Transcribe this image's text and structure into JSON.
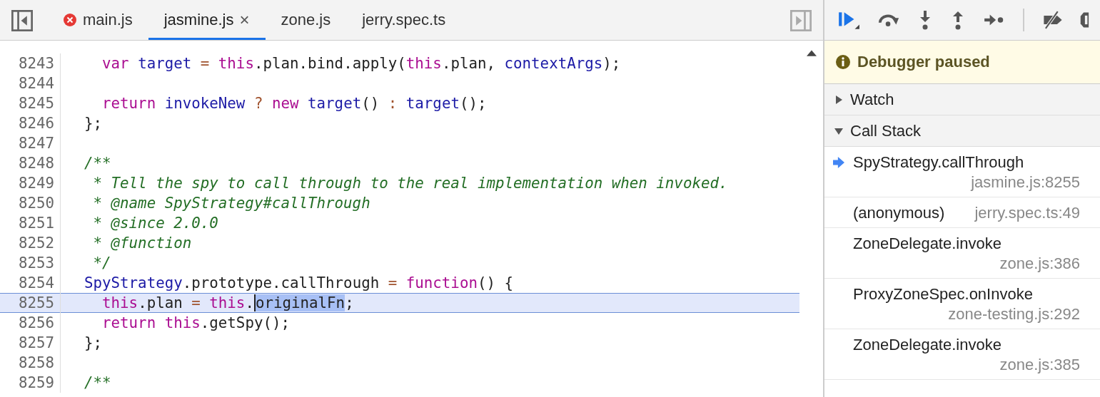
{
  "tabs": [
    {
      "label": "main.js",
      "selected": false,
      "error": true
    },
    {
      "label": "jasmine.js",
      "selected": true,
      "close": "×"
    },
    {
      "label": "zone.js",
      "selected": false
    },
    {
      "label": "jerry.spec.ts",
      "selected": false
    }
  ],
  "code": [
    {
      "num": "8243",
      "selected": false,
      "tokens": [
        {
          "t": "  var",
          "kind": "kw"
        },
        {
          "t": " target",
          "kind": "def"
        },
        {
          "t": " =",
          "kind": "op"
        },
        {
          "t": " this",
          "kind": "kw"
        },
        {
          "t": ".plan.bind.apply(",
          "kind": "plain"
        },
        {
          "t": "this",
          "kind": "kw"
        },
        {
          "t": ".plan, ",
          "kind": "plain"
        },
        {
          "t": "contextArgs",
          "kind": "def"
        },
        {
          "t": ");",
          "kind": "plain"
        }
      ]
    },
    {
      "num": "8244",
      "selected": false
    },
    {
      "num": "8245",
      "selected": false,
      "tokens": [
        {
          "t": "  return",
          "kind": "kw"
        },
        {
          "t": " invokeNew",
          "kind": "def"
        },
        {
          "t": " ?",
          "kind": "op"
        },
        {
          "t": " new",
          "kind": "kw"
        },
        {
          "t": " target",
          "kind": "def"
        },
        {
          "t": "()",
          "kind": "plain"
        },
        {
          "t": " :",
          "kind": "op"
        },
        {
          "t": " target",
          "kind": "def"
        },
        {
          "t": "();",
          "kind": "plain"
        }
      ]
    },
    {
      "num": "8246",
      "selected": false,
      "tokens": [
        {
          "t": "};",
          "kind": "plain"
        }
      ]
    },
    {
      "num": "8247",
      "selected": false
    },
    {
      "num": "8248",
      "selected": false,
      "tokens": [
        {
          "t": "/**",
          "kind": "comment"
        }
      ]
    },
    {
      "num": "8249",
      "selected": false,
      "tokens": [
        {
          "t": " * Tell the spy to call through to the real implementation when invoked.",
          "kind": "comment"
        }
      ]
    },
    {
      "num": "8250",
      "selected": false,
      "tokens": [
        {
          "t": " * @name SpyStrategy#callThrough",
          "kind": "comment"
        }
      ]
    },
    {
      "num": "8251",
      "selected": false,
      "tokens": [
        {
          "t": " * @since 2.0.0",
          "kind": "comment"
        }
      ]
    },
    {
      "num": "8252",
      "selected": false,
      "tokens": [
        {
          "t": " * @function",
          "kind": "comment"
        }
      ]
    },
    {
      "num": "8253",
      "selected": false,
      "tokens": [
        {
          "t": " */",
          "kind": "comment"
        }
      ]
    },
    {
      "num": "8254",
      "selected": false,
      "tokens": [
        {
          "t": "SpyStrategy",
          "kind": "def"
        },
        {
          "t": ".prototype.callThrough",
          "kind": "plain"
        },
        {
          "t": " =",
          "kind": "op"
        },
        {
          "t": " function",
          "kind": "kw"
        },
        {
          "t": "() {",
          "kind": "plain"
        }
      ]
    },
    {
      "num": "8255",
      "selected": true,
      "tokens": [
        {
          "t": "  this",
          "kind": "kw"
        },
        {
          "t": ".plan",
          "kind": "plain"
        },
        {
          "t": " =",
          "kind": "op"
        },
        {
          "t": " this",
          "kind": "kw"
        },
        {
          "t": ".",
          "kind": "plain"
        },
        {
          "t": "originalFn",
          "kind": "sel"
        },
        {
          "t": ";",
          "kind": "plain"
        }
      ]
    },
    {
      "num": "8256",
      "selected": false,
      "tokens": [
        {
          "t": "  return",
          "kind": "kw"
        },
        {
          "t": " this",
          "kind": "kw"
        },
        {
          "t": ".getSpy();",
          "kind": "plain"
        }
      ]
    },
    {
      "num": "8257",
      "selected": false,
      "tokens": [
        {
          "t": "};",
          "kind": "plain"
        }
      ]
    },
    {
      "num": "8258",
      "selected": false
    },
    {
      "num": "8259",
      "selected": false,
      "tokens": [
        {
          "t": "/**",
          "kind": "comment"
        }
      ]
    }
  ],
  "banner": {
    "text": "Debugger paused"
  },
  "sections": [
    {
      "title": "Watch",
      "expanded": false
    },
    {
      "title": "Call Stack",
      "expanded": true
    }
  ],
  "call_stack": [
    {
      "name": "SpyStrategy.callThrough",
      "location": "jasmine.js:8255",
      "selected": true
    },
    {
      "name": "(anonymous)",
      "location": "jerry.spec.ts:49",
      "selected": false
    },
    {
      "name": "ZoneDelegate.invoke",
      "location": "zone.js:386",
      "selected": false
    },
    {
      "name": "ProxyZoneSpec.onInvoke",
      "location": "zone-testing.js:292",
      "selected": false
    },
    {
      "name": "ZoneDelegate.invoke",
      "location": "zone.js:385",
      "selected": false
    }
  ]
}
